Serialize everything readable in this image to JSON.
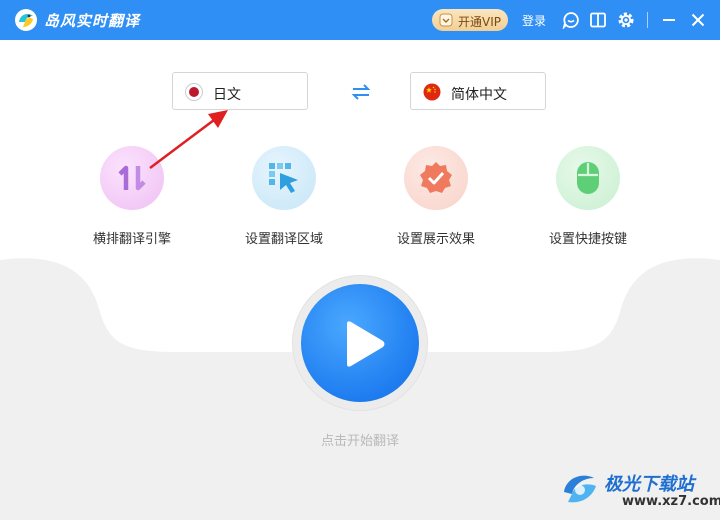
{
  "titlebar": {
    "app_title": "岛风实时翻译",
    "vip_label": "开通VIP",
    "login_label": "登录",
    "icons": [
      "app-logo-icon",
      "vip-crown-icon",
      "chat-icon",
      "book-icon",
      "gear-icon",
      "minimize-icon",
      "close-icon"
    ]
  },
  "languages": {
    "source": "日文",
    "target": "简体中文",
    "swap_icon": "swap-arrows-icon"
  },
  "features": [
    {
      "label": "横排翻译引擎",
      "icon": "vertical-arrows-icon",
      "color": "#f2c9f5"
    },
    {
      "label": "设置翻译区域",
      "icon": "area-select-icon",
      "color": "#cfeaf8"
    },
    {
      "label": "设置展示效果",
      "icon": "badge-check-icon",
      "color": "#fbdcd4"
    },
    {
      "label": "设置快捷按键",
      "icon": "mouse-icon",
      "color": "#d7f4dc"
    }
  ],
  "start": {
    "label": "点击开始翻译",
    "icon": "play-icon"
  },
  "watermark": {
    "main": "极光下载站",
    "sub": "www.xz7.com"
  },
  "colors": {
    "titlebar": "#2f8ff4",
    "accent": "#1f7df0",
    "annotation_arrow": "#e02020"
  }
}
